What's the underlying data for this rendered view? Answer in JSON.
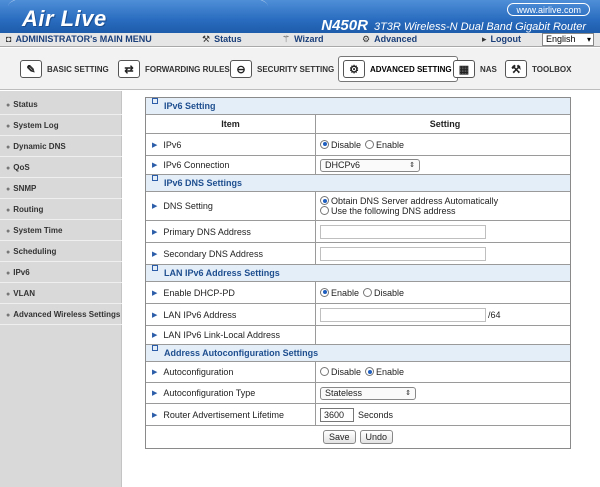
{
  "brand": {
    "logo": "Air Live",
    "url": "www.airlive.com",
    "model": "N450R",
    "model_desc": "3T3R Wireless-N Dual Band Gigabit Router"
  },
  "topnav": {
    "admin_menu": "ADMINISTRATOR's MAIN MENU",
    "status": "Status",
    "wizard": "Wizard",
    "advanced": "Advanced",
    "logout": "Logout",
    "language": "English"
  },
  "tabs": [
    "BASIC SETTING",
    "FORWARDING RULES",
    "SECURITY SETTING",
    "ADVANCED SETTING",
    "NAS",
    "TOOLBOX"
  ],
  "sidebar": [
    "Status",
    "System Log",
    "Dynamic DNS",
    "QoS",
    "SNMP",
    "Routing",
    "System Time",
    "Scheduling",
    "IPv6",
    "VLAN",
    "Advanced Wireless Settings"
  ],
  "table": {
    "title": "IPv6 Setting",
    "col_item": "Item",
    "col_setting": "Setting",
    "ipv6_label": "IPv6",
    "ipv6_disable": "Disable",
    "ipv6_enable": "Enable",
    "ipv6_state": "Disable",
    "conn_label": "IPv6 Connection",
    "conn_value": "DHCPv6",
    "dns_section": "IPv6 DNS Settings",
    "dns_label": "DNS Setting",
    "dns_auto": "Obtain DNS Server address Automatically",
    "dns_manual": "Use the following DNS address",
    "primary_dns_label": "Primary DNS Address",
    "primary_dns_value": "",
    "secondary_dns_label": "Secondary DNS Address",
    "secondary_dns_value": "",
    "lan_section": "LAN IPv6 Address Settings",
    "dhcppd_label": "Enable DHCP-PD",
    "dhcppd_enable": "Enable",
    "dhcppd_disable": "Disable",
    "lan_addr_label": "LAN IPv6 Address",
    "lan_addr_value": "",
    "lan_prefix": "/64",
    "lan_link_label": "LAN IPv6 Link-Local Address",
    "lan_link_value": "",
    "auto_section": "Address Autoconfiguration Settings",
    "autoconf_label": "Autoconfiguration",
    "autoconf_disable": "Disable",
    "autoconf_enable": "Enable",
    "autotype_label": "Autoconfiguration Type",
    "autotype_value": "Stateless",
    "lifetime_label": "Router Advertisement Lifetime",
    "lifetime_value": "3600",
    "lifetime_unit": "Seconds",
    "save": "Save",
    "undo": "Undo"
  }
}
